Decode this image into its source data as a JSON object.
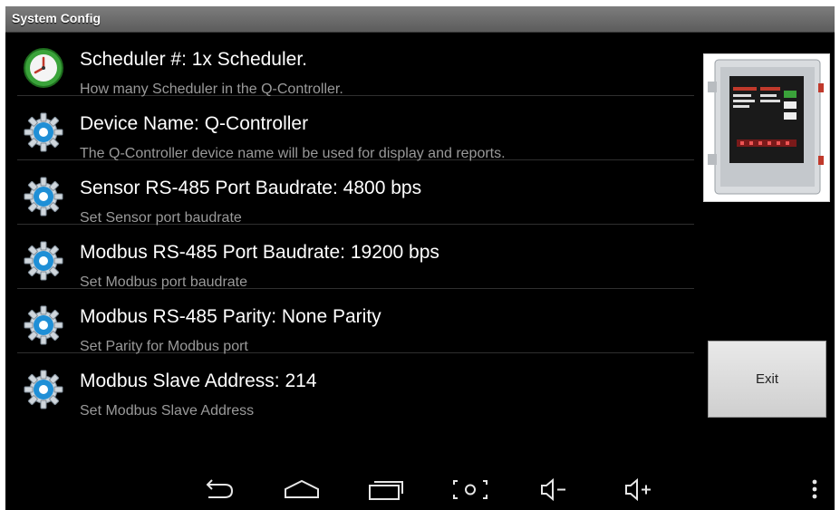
{
  "window": {
    "title": "System Config"
  },
  "settings": [
    {
      "icon": "clock-icon",
      "title": "Scheduler #: 1x Scheduler.",
      "subtitle": "How many Scheduler in the Q-Controller."
    },
    {
      "icon": "gear-icon",
      "title": "Device Name: Q-Controller",
      "subtitle": "The Q-Controller device name will be used for display and reports."
    },
    {
      "icon": "gear-icon",
      "title": "Sensor RS-485 Port Baudrate: 4800 bps",
      "subtitle": "Set Sensor port baudrate"
    },
    {
      "icon": "gear-icon",
      "title": "Modbus RS-485 Port Baudrate: 19200 bps",
      "subtitle": "Set Modbus port baudrate"
    },
    {
      "icon": "gear-icon",
      "title": "Modbus RS-485 Parity: None Parity",
      "subtitle": "Set Parity for Modbus port"
    },
    {
      "icon": "gear-icon",
      "title": "Modbus Slave Address: 214",
      "subtitle": "Set Modbus Slave Address"
    }
  ],
  "device_image": {
    "icon": "q-controller-device-image"
  },
  "exit_button": {
    "label": "Exit"
  },
  "navbar": {
    "icons": [
      "back-icon",
      "home-icon",
      "recent-apps-icon",
      "screenshot-icon",
      "volume-down-icon",
      "volume-up-icon",
      "overflow-menu-icon"
    ]
  },
  "colors": {
    "background": "#000000",
    "titlebar": "#6a6a6a",
    "gear_blue": "#1f8fd6",
    "clock_green": "#3aa33a"
  }
}
